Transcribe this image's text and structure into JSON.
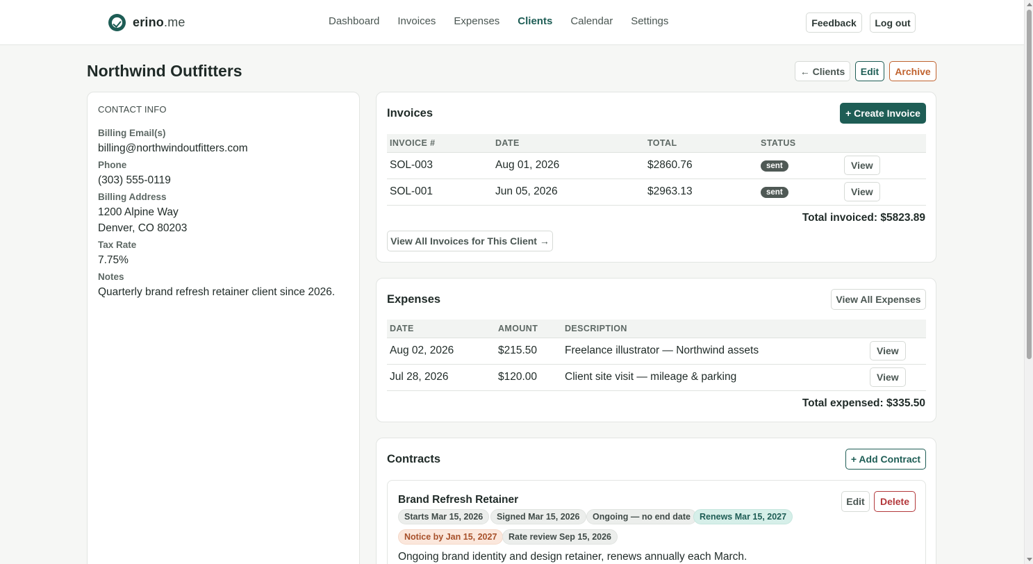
{
  "brand": {
    "name": "erino",
    "suffix": ".me"
  },
  "nav": [
    "Dashboard",
    "Invoices",
    "Expenses",
    "Clients",
    "Calendar",
    "Settings"
  ],
  "nav_active": "Clients",
  "top_actions": {
    "feedback": "Feedback",
    "logout": "Log out"
  },
  "page": {
    "title": "Northwind Outfitters",
    "back": "← Clients",
    "edit": "Edit",
    "archive": "Archive"
  },
  "contact": {
    "heading": "CONTACT INFO",
    "email_label": "Billing Email(s)",
    "email": "billing@northwindoutfitters.com",
    "phone_label": "Phone",
    "phone": "(303) 555-0119",
    "address_label": "Billing Address",
    "address_line1": "1200 Alpine Way",
    "address_line2": "Denver, CO 80203",
    "tax_label": "Tax Rate",
    "tax": "7.75%",
    "notes_label": "Notes",
    "notes": "Quarterly brand refresh retainer client since 2026."
  },
  "invoices": {
    "title": "Invoices",
    "create": "+ Create Invoice",
    "columns": [
      "INVOICE #",
      "DATE",
      "TOTAL",
      "STATUS"
    ],
    "rows": [
      {
        "number": "SOL-003",
        "date": "Aug 01, 2026",
        "total": "$2860.76",
        "status": "sent",
        "action": "View"
      },
      {
        "number": "SOL-001",
        "date": "Jun 05, 2026",
        "total": "$2963.13",
        "status": "sent",
        "action": "View"
      }
    ],
    "total": "Total invoiced: $5823.89",
    "view_all": "View All Invoices for This Client →"
  },
  "expenses": {
    "title": "Expenses",
    "view_all": "View All Expenses",
    "columns": [
      "DATE",
      "AMOUNT",
      "DESCRIPTION"
    ],
    "rows": [
      {
        "date": "Aug 02, 2026",
        "amount": "$215.50",
        "description": "Freelance illustrator — Northwind assets",
        "action": "View"
      },
      {
        "date": "Jul 28, 2026",
        "amount": "$120.00",
        "description": "Client site visit — mileage & parking",
        "action": "View"
      }
    ],
    "total": "Total expensed: $335.50"
  },
  "contracts": {
    "title": "Contracts",
    "add": "+ Add Contract",
    "items": [
      {
        "name": "Brand Refresh Retainer",
        "edit": "Edit",
        "delete": "Delete",
        "tags": [
          "Starts Mar 15, 2026",
          "Signed Mar 15, 2026",
          "Ongoing — no end date",
          "Renews Mar 15, 2027",
          "Notice by Jan 15, 2027",
          "Rate review Sep 15, 2026"
        ],
        "description": "Ongoing brand identity and design retainer, renews annually each March."
      }
    ]
  },
  "colors": {
    "accent": "#1e5d55",
    "archive": "#c0622e",
    "delete": "#b3383b",
    "badge": "#4f5955"
  }
}
